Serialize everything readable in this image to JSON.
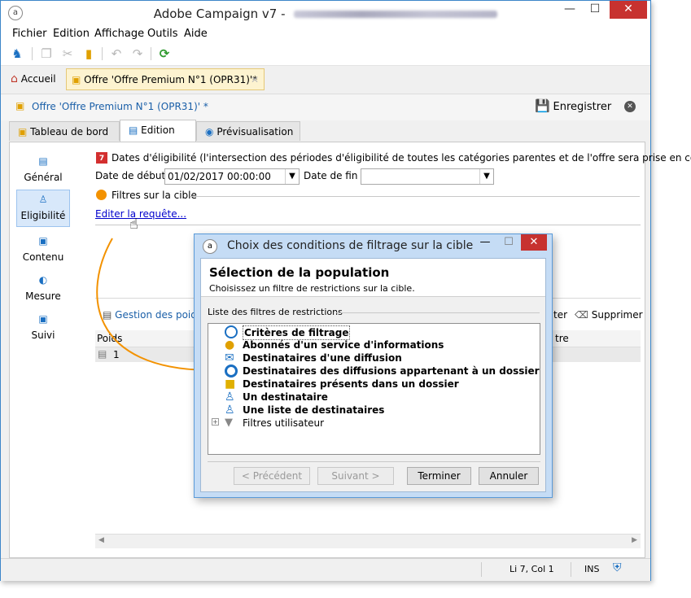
{
  "window": {
    "title": "Adobe Campaign v7 - ",
    "minimize": "—",
    "maximize": "☐",
    "close": "✕"
  },
  "menu": [
    "Fichier",
    "Edition",
    "Affichage",
    "Outils",
    "Aide"
  ],
  "tabs": {
    "home": "Accueil",
    "doc": "Offre 'Offre Premium N°1 (OPR31)'*"
  },
  "doc_header": {
    "title": "Offre 'Offre Premium N°1 (OPR31)' *",
    "save": "Enregistrer"
  },
  "subtabs": [
    "Tableau de bord",
    "Edition",
    "Prévisualisation"
  ],
  "sidebar": [
    {
      "label": "Général",
      "icon": "clipboard-icon"
    },
    {
      "label": "Eligibilité",
      "icon": "people-icon",
      "active": true
    },
    {
      "label": "Contenu",
      "icon": "image-icon"
    },
    {
      "label": "Mesure",
      "icon": "gauge-icon"
    },
    {
      "label": "Suivi",
      "icon": "tracking-icon"
    }
  ],
  "eligibility": {
    "dates_label": "Dates d'éligibilité (l'intersection des périodes d'éligibilité de toutes les catégories parentes et de l'offre sera prise en compte)",
    "start_label": "Date de début :",
    "start_value": "01/02/2017 00:00:00",
    "end_label": "Date de fin :",
    "end_value": "",
    "filters_label": "Filtres sur la cible",
    "edit_query": "Editer la requête...",
    "weights_mgmt": "Gestion des poids",
    "delete": "Supprimer",
    "ter_partial": "ter",
    "col_weight": "Poids",
    "col_other_partial": "tre",
    "row_value": "1"
  },
  "dialog": {
    "title": "Choix des conditions de filtrage sur la cible",
    "heading": "Sélection de la population",
    "subheading": "Choisissez un filtre de restrictions sur la cible.",
    "list_label": "Liste des filtres de restrictions",
    "items": [
      "Critères de filtrage",
      "Abonnés d'un service d'informations",
      "Destinataires d'une diffusion",
      "Destinataires des diffusions appartenant à un dossier",
      "Destinataires présents dans un dossier",
      "Un destinataire",
      "Une liste de destinataires",
      "Filtres utilisateur"
    ],
    "btn_prev": "< Précédent",
    "btn_next": "Suivant >",
    "btn_finish": "Terminer",
    "btn_cancel": "Annuler"
  },
  "status": {
    "position": "Li 7, Col 1",
    "mode": "INS"
  },
  "colors": {
    "accent": "#f39200",
    "link": "#0000cc",
    "dialog_frame": "#c5dcf5"
  }
}
